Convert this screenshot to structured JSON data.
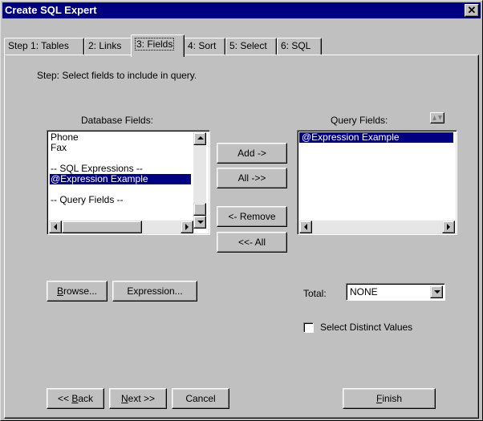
{
  "window": {
    "title": "Create SQL Expert",
    "close_glyph": "✕"
  },
  "tabs": [
    {
      "label": "Step 1: Tables",
      "active": false
    },
    {
      "label": "2: Links",
      "active": false
    },
    {
      "label": "3: Fields",
      "active": true
    },
    {
      "label": "4: Sort",
      "active": false
    },
    {
      "label": "5: Select",
      "active": false
    },
    {
      "label": "6: SQL",
      "active": false
    }
  ],
  "step_text": "Step:  Select fields to include in query.",
  "database_fields": {
    "label": "Database Fields:",
    "items": [
      "Phone",
      "Fax",
      "",
      "-- SQL Expressions --",
      "@Expression Example",
      "",
      "-- Query Fields --"
    ],
    "selected_index": 4
  },
  "query_fields": {
    "label": "Query Fields:",
    "items": [
      "@Expression Example"
    ],
    "selected_index": 0
  },
  "move_buttons": {
    "add": "Add ->",
    "all": "All ->>",
    "remove": "<- Remove",
    "remove_all": "<<- All"
  },
  "browse_button": {
    "pre": "",
    "accel": "B",
    "post": "rowse..."
  },
  "expression_button": "Expression...",
  "total": {
    "label": "Total:",
    "value": "NONE"
  },
  "distinct": {
    "label": "Select Distinct Values",
    "checked": false
  },
  "footer": {
    "back": {
      "pre": "<< ",
      "accel": "B",
      "post": "ack"
    },
    "next": {
      "pre": "",
      "accel": "N",
      "post": "ext >>"
    },
    "cancel": "Cancel",
    "finish": {
      "pre": "",
      "accel": "F",
      "post": "inish"
    }
  },
  "icons": {
    "scroll_up": "triangle-up",
    "scroll_down": "triangle-down",
    "scroll_left": "triangle-left",
    "scroll_right": "triangle-right",
    "reorder": "up-down-arrows"
  },
  "colors": {
    "title_bar": "#000080",
    "selection": "#000080",
    "face": "#c0c0c0"
  }
}
